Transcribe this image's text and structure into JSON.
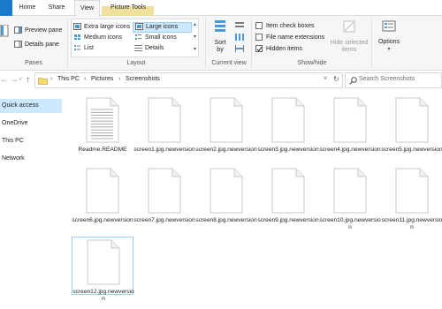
{
  "tabs": {
    "file": "",
    "home": "Home",
    "share": "Share",
    "view": "View",
    "picture_tools": "Picture Tools"
  },
  "ribbon": {
    "panes": {
      "preview_pane": "Preview pane",
      "details_pane": "Details pane",
      "label": "Panes"
    },
    "layout": {
      "extra_large_icons": "Extra large icons",
      "large_icons": "Large icons",
      "medium_icons": "Medium icons",
      "small_icons": "Small icons",
      "list": "List",
      "details": "Details",
      "label": "Layout"
    },
    "current_view": {
      "sort_by": "Sort",
      "sort_by2": "by",
      "label": "Current view"
    },
    "show_hide": {
      "item_check_boxes": "Item check boxes",
      "file_name_extensions": "File name extensions",
      "hidden_items": "Hidden items",
      "hide_selected_items_1": "Hide selected",
      "hide_selected_items_2": "items",
      "label": "Show/hide",
      "item_check_boxes_checked": false,
      "file_name_extensions_checked": false,
      "hidden_items_checked": true
    },
    "options": {
      "label": "Options"
    }
  },
  "address": {
    "crumbs": [
      "This PC",
      "Pictures",
      "Screenshots"
    ],
    "sep": "›"
  },
  "search": {
    "placeholder": "Search Screenshots"
  },
  "nav": {
    "items": [
      "Quick access",
      "OneDrive",
      "This PC",
      "Network"
    ]
  },
  "files": [
    {
      "name": "Readme.README",
      "type": "text"
    },
    {
      "name": "screen1.jpg.newversion",
      "type": "blank"
    },
    {
      "name": "screen2.jpg.newversion",
      "type": "blank"
    },
    {
      "name": "screen3.jpg.newversion",
      "type": "blank"
    },
    {
      "name": "screen4.jpg.newversion",
      "type": "blank"
    },
    {
      "name": "screen5.jpg.newversion",
      "type": "blank"
    },
    {
      "name": "screen6.jpg.newversion",
      "type": "blank"
    },
    {
      "name": "screen7.jpg.newversion",
      "type": "blank"
    },
    {
      "name": "screen8.jpg.newversion",
      "type": "blank"
    },
    {
      "name": "screen9.jpg.newversion",
      "type": "blank"
    },
    {
      "name": "screen10.jpg.newversion",
      "type": "blank"
    },
    {
      "name": "screen11.jpg.newversion",
      "type": "blank"
    },
    {
      "name": "screen12.jpg.newversion",
      "type": "blank"
    }
  ],
  "colors": {
    "selection": "#cce8ff",
    "accent": "#1979ca",
    "picture_tools": "#f5e7a8"
  }
}
